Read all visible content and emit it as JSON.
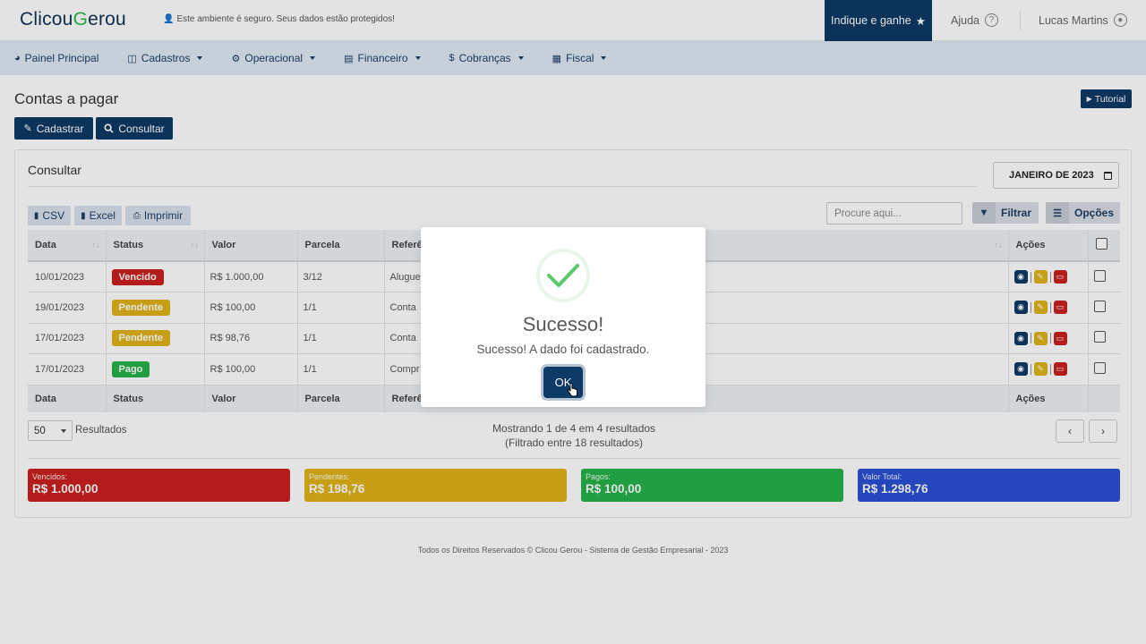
{
  "header": {
    "logo_a": "Clicou",
    "logo_b": "G",
    "logo_c": "erou",
    "secure_text": "Este ambiente é seguro. Seus dados estão protegidos!",
    "indique": "Indique e ganhe",
    "ajuda": "Ajuda",
    "user": "Lucas Martins"
  },
  "nav": [
    {
      "label": "Painel Principal",
      "icon": "dashboard-icon"
    },
    {
      "label": "Cadastros",
      "icon": "database-icon"
    },
    {
      "label": "Operacional",
      "icon": "cogs-icon"
    },
    {
      "label": "Financeiro",
      "icon": "wallet-icon"
    },
    {
      "label": "Cobranças",
      "icon": "dollar-icon"
    },
    {
      "label": "Fiscal",
      "icon": "building-icon"
    }
  ],
  "page": {
    "title": "Contas a pagar",
    "tutorial": "Tutorial",
    "cadastrar": "Cadastrar",
    "consultar": "Consultar"
  },
  "card": {
    "title": "Consultar",
    "month": "JANEIRO DE 2023",
    "csv": "CSV",
    "excel": "Excel",
    "imprimir": "Imprimir",
    "search_placeholder": "Procure aqui...",
    "filtrar": "Filtrar",
    "opcoes": "Opções"
  },
  "table": {
    "headers": [
      "Data",
      "Status",
      "Valor",
      "Parcela",
      "Referê",
      "Ações"
    ],
    "rows": [
      {
        "data": "10/01/2023",
        "status": "Vencido",
        "status_color": "#c9201f",
        "valor": "R$ 1.000,00",
        "parcela": "3/12",
        "ref": "Alugue"
      },
      {
        "data": "19/01/2023",
        "status": "Pendente",
        "status_color": "#e0b31a",
        "valor": "R$ 100,00",
        "parcela": "1/1",
        "ref": "Conta"
      },
      {
        "data": "17/01/2023",
        "status": "Pendente",
        "status_color": "#e0b31a",
        "valor": "R$ 98,76",
        "parcela": "1/1",
        "ref": "Conta"
      },
      {
        "data": "17/01/2023",
        "status": "Pago",
        "status_color": "#24b24a",
        "valor": "R$ 100,00",
        "parcela": "1/1",
        "ref": "Compr"
      }
    ]
  },
  "pagination": {
    "per_page": "50",
    "results_label": "Resultados",
    "showing": "Mostrando 1 de 4 em 4 resultados",
    "filtered": "(Filtrado entre 18 resultados)",
    "prev": "‹",
    "next": "›"
  },
  "totals": [
    {
      "label": "Vencidos:",
      "value": "R$ 1.000,00",
      "color": "#c9201f"
    },
    {
      "label": "Pendentes:",
      "value": "R$ 198,76",
      "color": "#e0b31a"
    },
    {
      "label": "Pagos:",
      "value": "R$ 100,00",
      "color": "#24b24a"
    },
    {
      "label": "Valor Total:",
      "value": "R$ 1.298,76",
      "color": "#2b4fd6"
    }
  ],
  "footer": "Todos os Direitos Reservados © Clicou Gerou - Sistema de Gestão Empresarial - 2023",
  "modal": {
    "title": "Sucesso!",
    "text": "Sucesso! A dado foi cadastrado.",
    "ok": "OK"
  }
}
